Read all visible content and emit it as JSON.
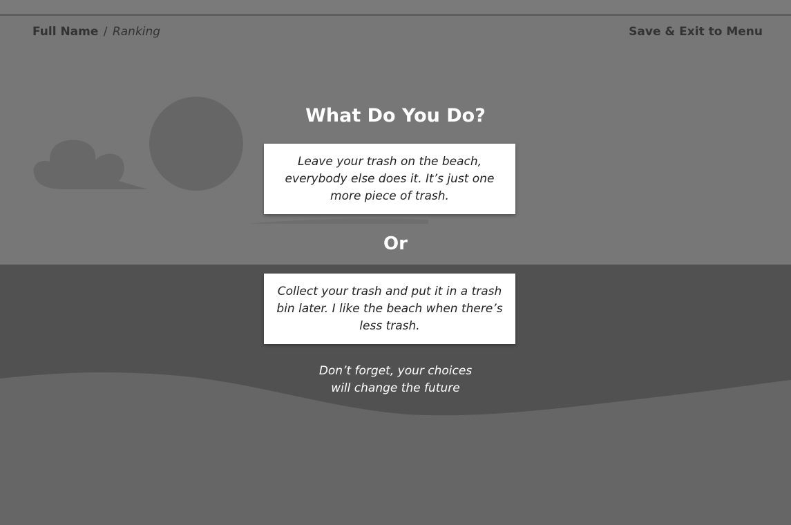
{
  "header": {
    "player_name": "Full Name",
    "separator": "/",
    "mode": "Ranking",
    "exit_label": "Save & Exit to Menu"
  },
  "prompt": {
    "title": "What Do You Do?",
    "or_label": "Or",
    "option_a": "Leave your trash on the beach, everybody else does it. It’s just one more piece of trash.",
    "option_b": "Collect your trash and put it in a trash bin later. I like the beach when there’s less trash.",
    "reminder_line1": "Don’t forget, your choices",
    "reminder_line2": "will change the future"
  },
  "colors": {
    "sky": "#777777",
    "sea": "#515151",
    "sand": "#666666",
    "sun": "#666666",
    "cloud": "#686868",
    "card": "#ffffff",
    "text_on_card": "#222222",
    "text_on_scene": "#ffffff"
  },
  "icons": {
    "cloud": "cloud-icon",
    "sun": "sun-icon"
  }
}
